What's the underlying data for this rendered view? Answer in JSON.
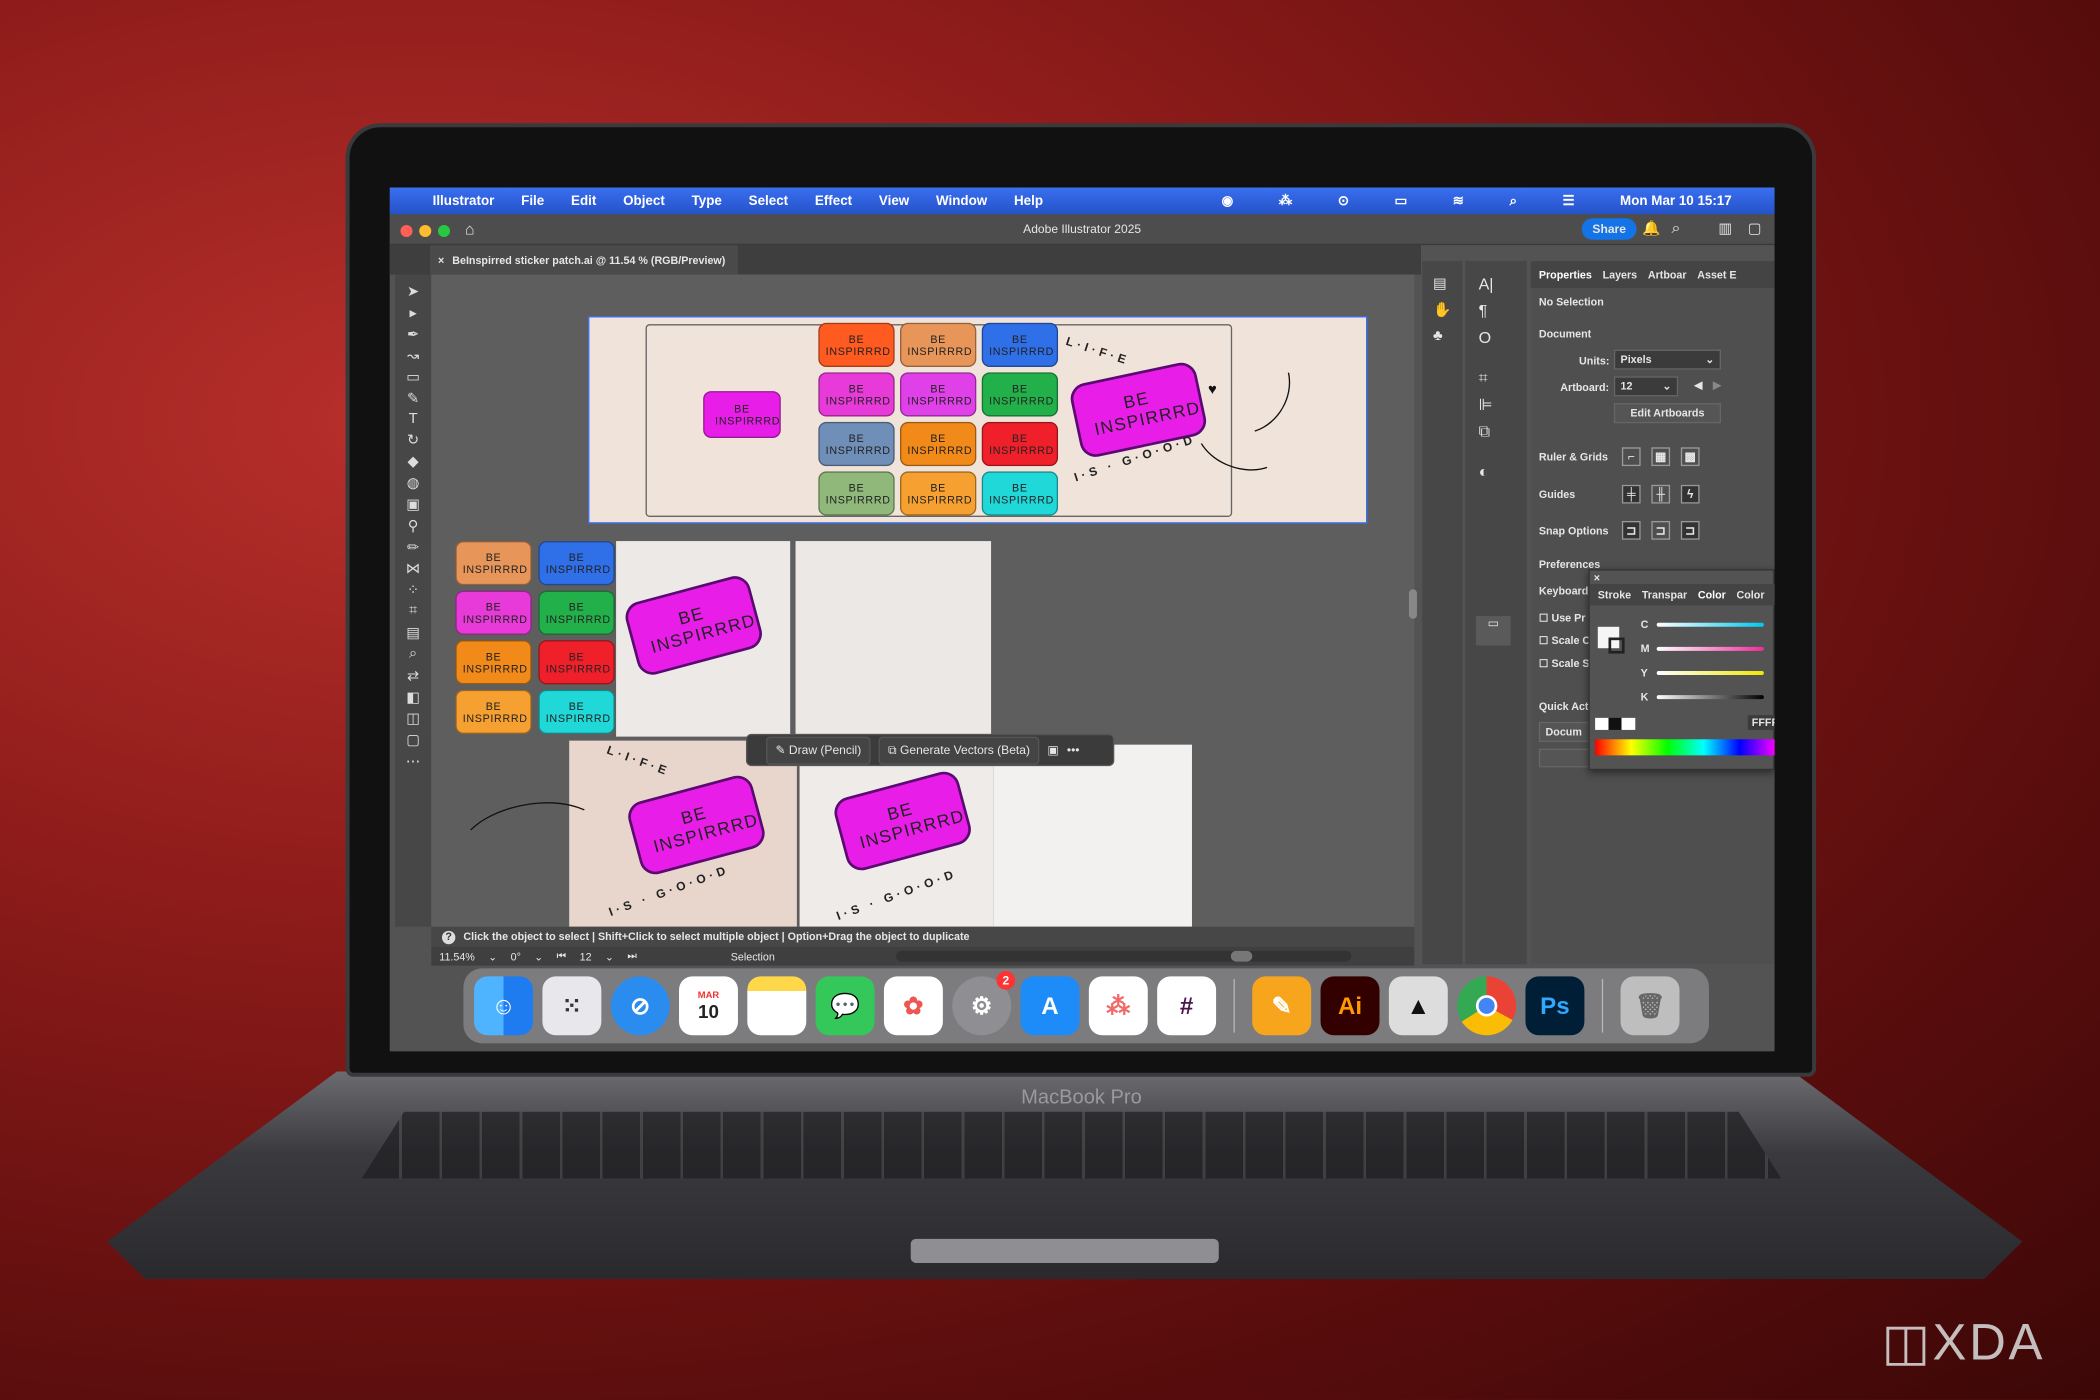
{
  "menubar": {
    "app": "Illustrator",
    "items": [
      "File",
      "Edit",
      "Object",
      "Type",
      "Select",
      "Effect",
      "View",
      "Window",
      "Help"
    ],
    "clock": "Mon Mar 10  15:17"
  },
  "titlebar": {
    "title": "Adobe Illustrator 2025",
    "share": "Share"
  },
  "doc_tab": {
    "label": "BeInspirred sticker patch.ai @ 11.54 % (RGB/Preview)"
  },
  "sticker_text": "BE INSPIRRRD",
  "sticker_line1": "BE",
  "sticker_line2": "INSPIRRRD",
  "ring_text": {
    "top": "L·I·F·E",
    "bottom": "I·S · G·O·O·D"
  },
  "colors": {
    "accent": "#2f6fe8",
    "magenta": "#e81ee8",
    "grid_top": [
      "#ff5a1f",
      "#e8955a",
      "#2f6fe8",
      "#e83ad8",
      "#e040e8",
      "#22b04a",
      "#6f8fb8",
      "#f28a1a",
      "#f0202a",
      "#8fb87a",
      "#f5a030",
      "#20d8d8"
    ],
    "grid_left": [
      "#e8955a",
      "#2f6fe8",
      "#e83ad8",
      "#22b04a",
      "#f28a1a",
      "#f0202a",
      "#f5a030",
      "#20d8d8"
    ]
  },
  "floating_toolbar": {
    "draw": "Draw (Pencil)",
    "generate": "Generate Vectors (Beta)",
    "more": "•••"
  },
  "status": {
    "hint": "Click the object to select  |  Shift+Click to select multiple object  |  Option+Drag the object to duplicate",
    "zoom": "11.54%",
    "rotation": "0°",
    "artboard": "12",
    "tool": "Selection"
  },
  "panel": {
    "tabs": [
      "Properties",
      "Layers",
      "Artboar",
      "Asset E"
    ],
    "no_selection": "No Selection",
    "document": "Document",
    "units_label": "Units:",
    "units_value": "Pixels",
    "artboard_label": "Artboard:",
    "artboard_value": "12",
    "edit_artboards": "Edit Artboards",
    "ruler_grids": "Ruler & Grids",
    "guides": "Guides",
    "snap_options": "Snap Options",
    "preferences": "Preferences",
    "keyboard": "Keyboard",
    "checks": [
      "Use Pr",
      "Scale C",
      "Scale S"
    ],
    "quick_actions": "Quick Acti",
    "docum": "Docum"
  },
  "color_panel": {
    "tabs": [
      "Stroke",
      "Transpar",
      "Color",
      "Color"
    ],
    "channels": [
      "C",
      "M",
      "Y",
      "K"
    ],
    "hex": "FFFF"
  },
  "dock": {
    "apps": [
      "Finder",
      "Launchpad",
      "Safari",
      "Calendar",
      "Notes",
      "Messages",
      "Photos",
      "System Settings",
      "App Store",
      "Asana",
      "Slack",
      "Pages",
      "Illustrator",
      "Inkscape",
      "Chrome",
      "Photoshop",
      "Trash"
    ],
    "calendar_month": "MAR",
    "calendar_day": "10",
    "settings_badge": "2",
    "ai_label": "Ai",
    "ps_label": "Ps"
  },
  "device": {
    "label": "MacBook Pro"
  },
  "watermark": "XDA"
}
